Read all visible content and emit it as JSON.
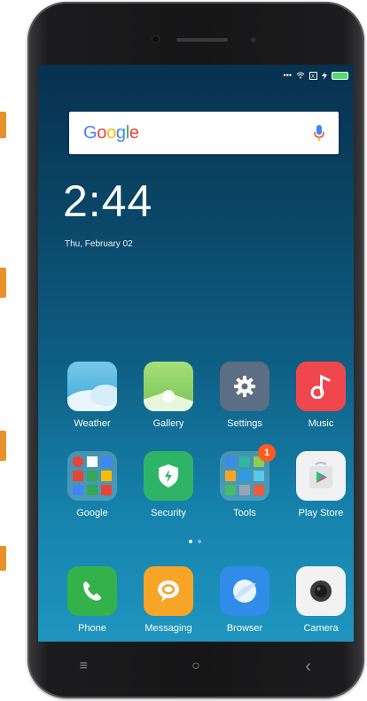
{
  "side_marks_color": "#e8902a",
  "status_bar": {
    "icons": [
      "signal-dots-icon",
      "wifi-icon",
      "sim-icon",
      "charging-icon",
      "battery-icon"
    ],
    "battery_color": "#4fdc6a"
  },
  "search_widget": {
    "logo": "Google",
    "mic_icon": "mic-icon"
  },
  "lock": {
    "time": "2:44",
    "date": "Thu, February 02"
  },
  "apps": [
    {
      "label": "Weather",
      "icon": "weather-icon"
    },
    {
      "label": "Gallery",
      "icon": "gallery-icon"
    },
    {
      "label": "Settings",
      "icon": "gear-icon"
    },
    {
      "label": "Music",
      "icon": "music-note-icon"
    },
    {
      "label": "Google",
      "icon": "google-folder-icon"
    },
    {
      "label": "Security",
      "icon": "shield-icon"
    },
    {
      "label": "Tools",
      "icon": "tools-folder-icon",
      "badge": "1"
    },
    {
      "label": "Play Store",
      "icon": "play-store-icon"
    }
  ],
  "dock": [
    {
      "label": "Phone",
      "icon": "phone-icon"
    },
    {
      "label": "Messaging",
      "icon": "message-bubble-icon"
    },
    {
      "label": "Browser",
      "icon": "browser-icon"
    },
    {
      "label": "Camera",
      "icon": "camera-icon"
    }
  ],
  "nav_bar": {
    "menu": "≡",
    "home": "○",
    "back": "‹"
  }
}
